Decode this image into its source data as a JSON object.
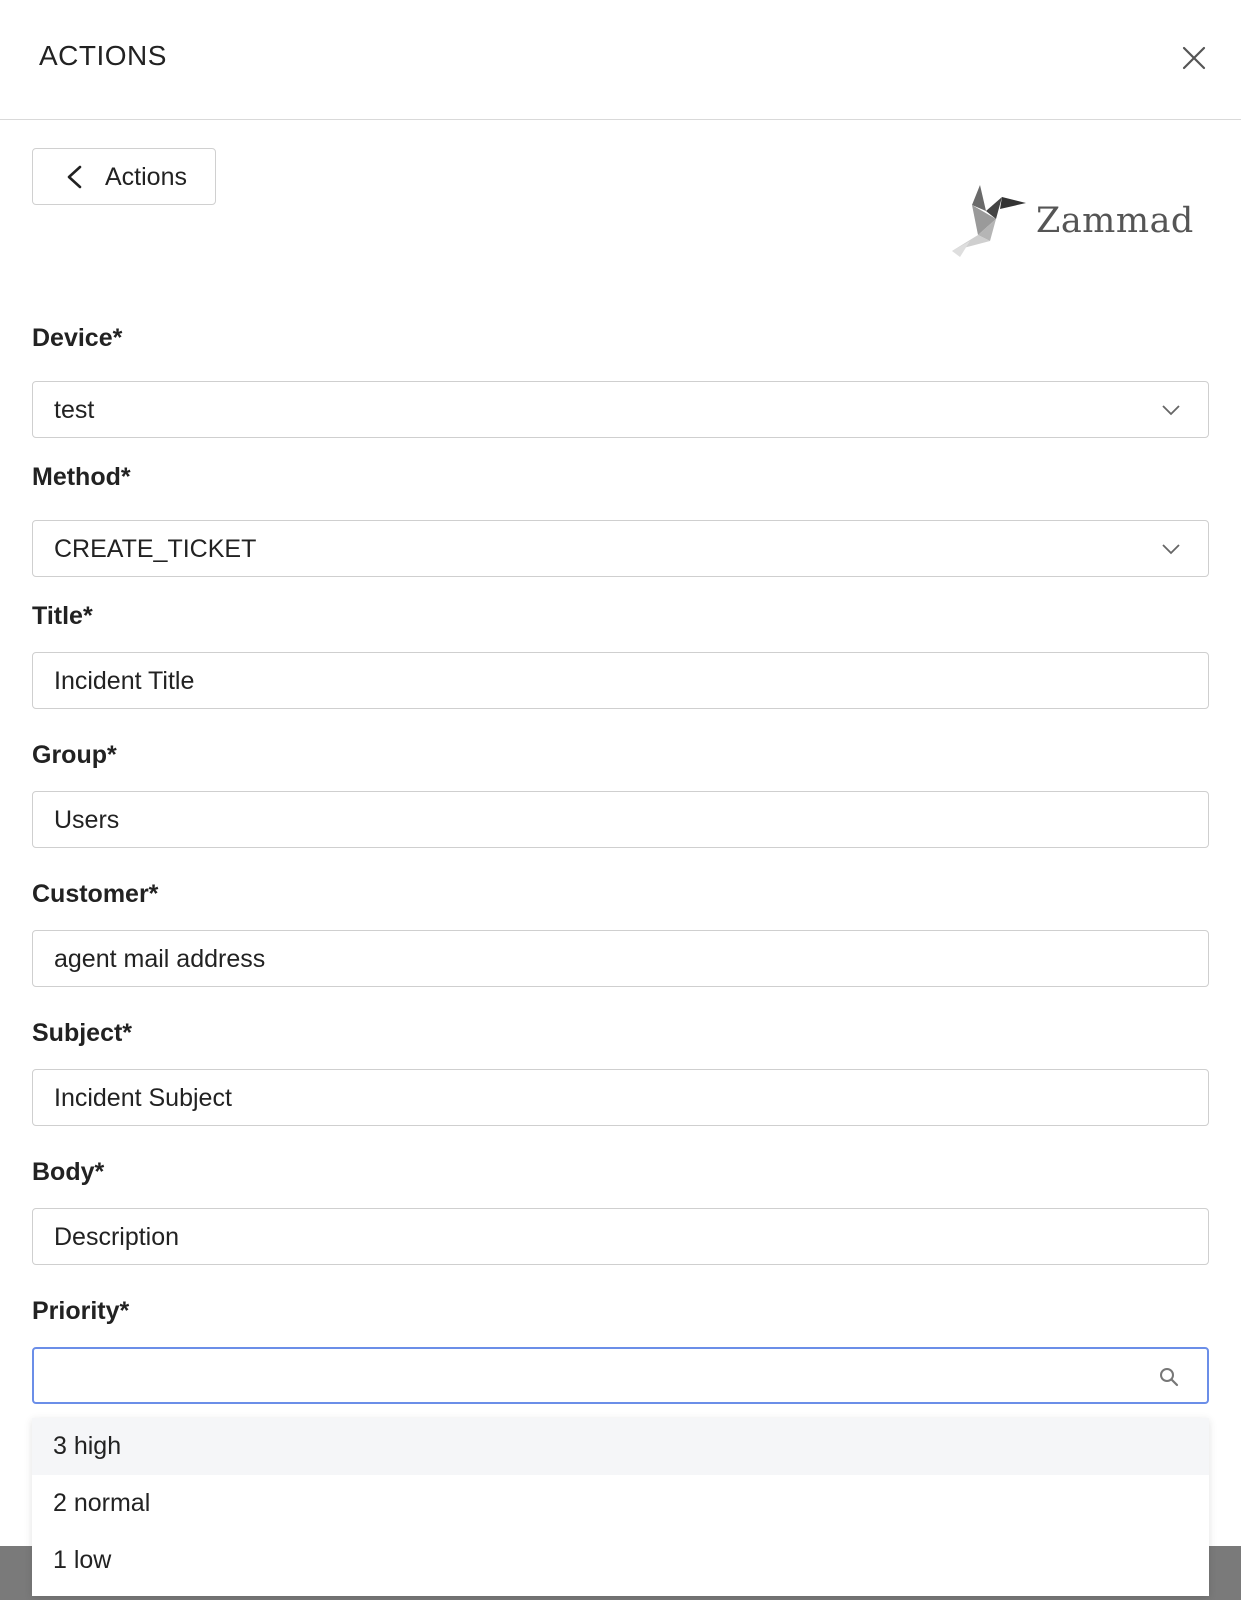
{
  "header": {
    "title": "ACTIONS"
  },
  "back_button": {
    "label": "Actions"
  },
  "logo": {
    "text": "Zammad"
  },
  "fields": {
    "device": {
      "label": "Device*",
      "value": "test"
    },
    "method": {
      "label": "Method*",
      "value": "CREATE_TICKET"
    },
    "title": {
      "label": "Title*",
      "value": "Incident Title"
    },
    "group": {
      "label": "Group*",
      "value": "Users"
    },
    "customer": {
      "label": "Customer*",
      "value": "agent mail address"
    },
    "subject": {
      "label": "Subject*",
      "value": "Incident Subject"
    },
    "body": {
      "label": "Body*",
      "value": "Description"
    },
    "priority": {
      "label": "Priority*",
      "value": ""
    }
  },
  "priority_options": [
    "3 high",
    "2 normal",
    "1 low"
  ],
  "colors": {
    "focus": "#6b8ee8",
    "border": "#cfcfcf",
    "highlight": "#f5f6f8"
  },
  "icons": [
    "close-icon",
    "chevron-left-icon",
    "chevron-down-icon",
    "search-icon",
    "zammad-bird-logo"
  ]
}
